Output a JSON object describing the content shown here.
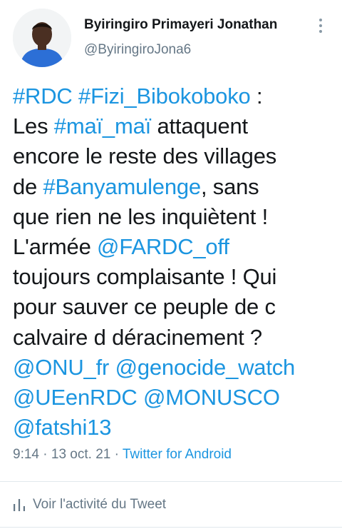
{
  "author": {
    "display_name": "Byiringiro Primayeri Jonathan",
    "handle": "@ByiringiroJona6"
  },
  "tweet": {
    "lines": [
      [
        {
          "text": "#RDC",
          "link": true
        },
        {
          "text": " ",
          "link": false
        },
        {
          "text": "#Fizi_Bibokoboko",
          "link": true
        },
        {
          "text": " :",
          "link": false
        }
      ],
      [
        {
          "text": "Les ",
          "link": false
        },
        {
          "text": "#maï_maï",
          "link": true
        },
        {
          "text": " attaquent",
          "link": false
        }
      ],
      [
        {
          "text": "encore le reste des villages",
          "link": false
        }
      ],
      [
        {
          "text": "de ",
          "link": false
        },
        {
          "text": "#Banyamulenge",
          "link": true
        },
        {
          "text": ", sans",
          "link": false
        }
      ],
      [
        {
          "text": "que rien ne les inquiètent !",
          "link": false
        }
      ],
      [
        {
          "text": "L'armée ",
          "link": false
        },
        {
          "text": "@FARDC_off",
          "link": true
        }
      ],
      [
        {
          "text": "toujours complaisante ! Qui",
          "link": false
        }
      ],
      [
        {
          "text": "pour sauver ce peuple de c",
          "link": false
        }
      ],
      [
        {
          "text": "calvaire d déracinement ?",
          "link": false
        }
      ],
      [
        {
          "text": "@ONU_fr",
          "link": true
        },
        {
          "text": " ",
          "link": false
        },
        {
          "text": "@genocide_watch",
          "link": true
        }
      ],
      [
        {
          "text": "@UEenRDC",
          "link": true
        },
        {
          "text": " ",
          "link": false
        },
        {
          "text": "@MONUSCO",
          "link": true
        }
      ],
      [
        {
          "text": "@fatshi13",
          "link": true
        }
      ]
    ]
  },
  "meta": {
    "time": "9:14",
    "separator": " · ",
    "date": "13 oct. 21",
    "source": "Twitter for Android"
  },
  "activity": {
    "label": "Voir l'activité du Tweet",
    "icon": "bar-chart-icon"
  },
  "colors": {
    "link": "#1b95e0",
    "text": "#14171a",
    "secondary": "#657786",
    "divider": "#e1e8ed"
  }
}
